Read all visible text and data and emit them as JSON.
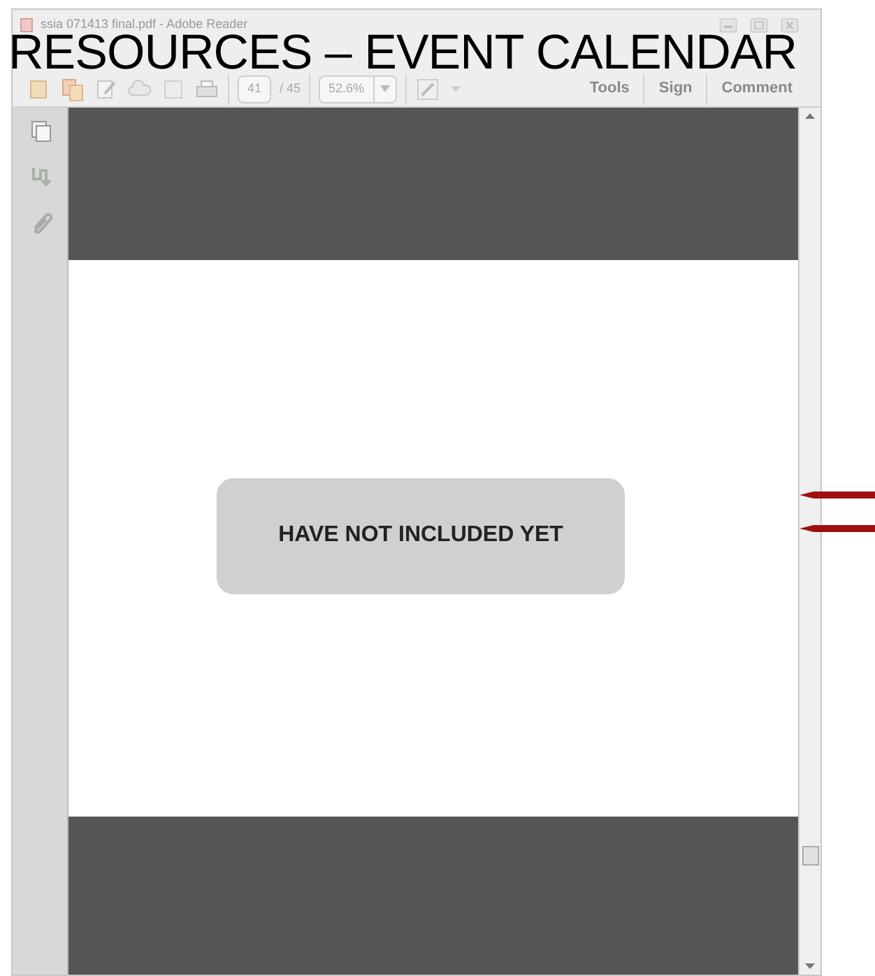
{
  "heading": "RESOURCES – EVENT CALENDAR",
  "window": {
    "title": "ssia 071413 final.pdf - Adobe Reader"
  },
  "toolbar": {
    "page": "41",
    "page_count": "/ 45",
    "zoom": "52.6%",
    "buttons": [
      "Tools",
      "Sign",
      "Comment"
    ]
  },
  "document": {
    "callout": "HAVE NOT INCLUDED YET"
  }
}
